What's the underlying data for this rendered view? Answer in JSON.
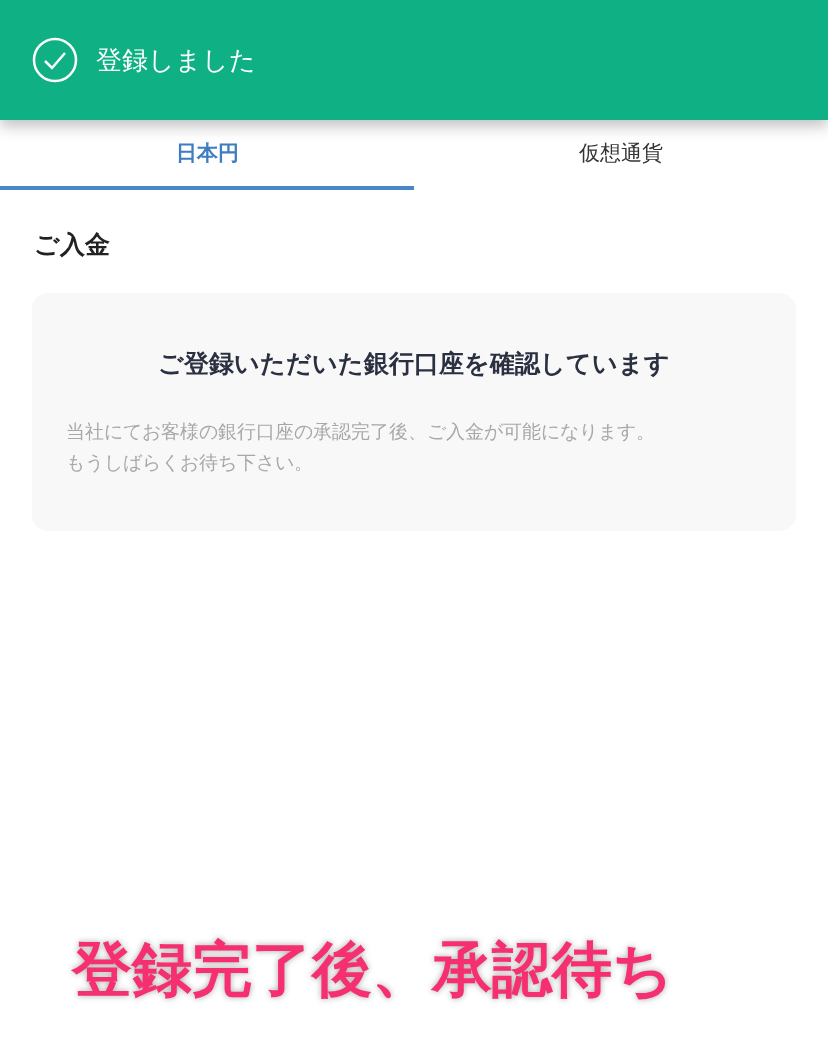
{
  "toast": {
    "message": "登録しました"
  },
  "tabs": [
    {
      "label": "日本円",
      "selected": true
    },
    {
      "label": "仮想通貨",
      "selected": false
    }
  ],
  "section": {
    "title": "ご入金"
  },
  "notice": {
    "title": "ご登録いただいた銀行口座を確認しています",
    "body": [
      "当社にてお客様の銀行口座の承認完了後、ご入金が可能になります。",
      "もうしばらくお待ち下さい。"
    ]
  },
  "caption": "登録完了後、承認待ち"
}
